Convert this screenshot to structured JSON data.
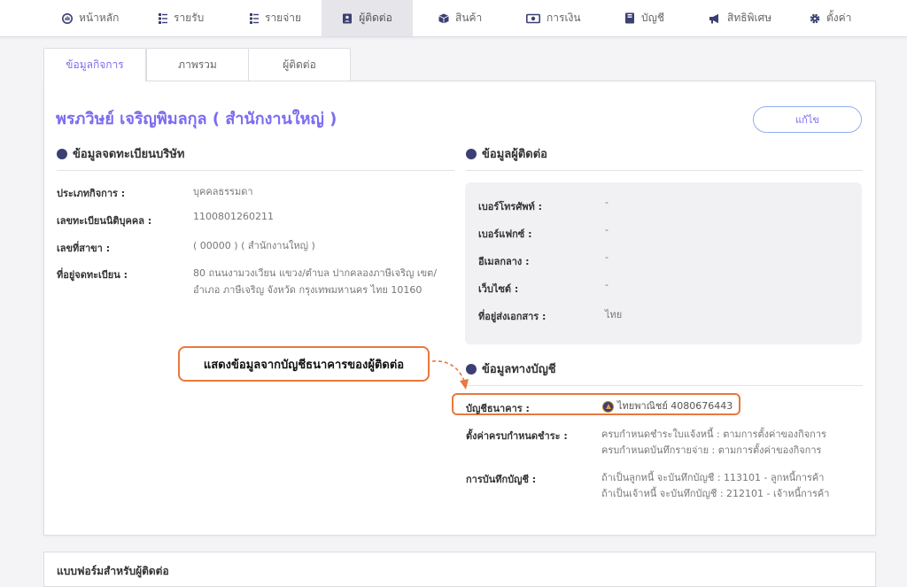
{
  "nav": [
    {
      "label": "หน้าหลัก",
      "icon": "dashboard-icon"
    },
    {
      "label": "รายรับ",
      "icon": "income-list-icon"
    },
    {
      "label": "รายจ่าย",
      "icon": "expense-list-icon"
    },
    {
      "label": "ผู้ติดต่อ",
      "icon": "contacts-icon",
      "active": true
    },
    {
      "label": "สินค้า",
      "icon": "product-box-icon"
    },
    {
      "label": "การเงิน",
      "icon": "money-icon"
    },
    {
      "label": "บัญชี",
      "icon": "accounting-book-icon"
    },
    {
      "label": "สิทธิพิเศษ",
      "icon": "megaphone-icon"
    },
    {
      "label": "ตั้งค่า",
      "icon": "gear-icon"
    }
  ],
  "tabs": [
    "ข้อมูลกิจการ",
    "ภาพรวม",
    "ผู้ติดต่อ"
  ],
  "title": "พรภวิษย์ เจริญพิมลกุล ( สำนักงานใหญ่ )",
  "edit_label": "แก้ไข",
  "registration": {
    "heading": "ข้อมูลจดทะเบียนบริษัท",
    "rows": [
      {
        "label": "ประเภทกิจการ :",
        "value": "บุคคลธรรมดา"
      },
      {
        "label": "เลขทะเบียนนิติบุคคล :",
        "value": "1100801260211"
      },
      {
        "label": "เลขที่สาขา :",
        "value": "( 00000 ) ( สำนักงานใหญ่ )"
      },
      {
        "label": "ที่อยู่จดทะเบียน :",
        "value": "80 ถนนงามวงเวียน แขวง/ตำบล ปากคลองภาษีเจริญ เขต/",
        "value2": "อำเภอ ภาษีเจริญ จังหวัด กรุงเทพมหานคร ไทย 10160"
      }
    ]
  },
  "contact": {
    "heading": "ข้อมูลผู้ติดต่อ",
    "rows": [
      {
        "label": "เบอร์โทรศัพท์ :",
        "value": "-"
      },
      {
        "label": "เบอร์แฟกซ์ :",
        "value": "-"
      },
      {
        "label": "อีเมลกลาง :",
        "value": "-"
      },
      {
        "label": "เว็บไซต์ :",
        "value": "-"
      },
      {
        "label": "ที่อยู่ส่งเอกสาร :",
        "value": "ไทย"
      }
    ]
  },
  "accounting": {
    "heading": "ข้อมูลทางบัญชี",
    "bank_label": "บัญชีธนาคาร :",
    "bank_value": "ไทยพาณิชย์ 4080676443",
    "due_label": "ตั้งค่าครบกำหนดชำระ :",
    "due_line1": "ครบกำหนดชำระใบแจ้งหนี้ : ตามการตั้งค่าของกิจการ",
    "due_line2": "ครบกำหนดบันทึกรายจ่าย : ตามการตั้งค่าของกิจการ",
    "record_label": "การบันทึกบัญชี :",
    "record_line1": "ถ้าเป็นลูกหนี้ จะบันทึกบัญชี : 113101 - ลูกหนี้การค้า",
    "record_line2": "ถ้าเป็นเจ้าหนี้ จะบันทึกบัญชี : 212101 - เจ้าหนี้การค้า"
  },
  "callout_text": "แสดงข้อมูลจากบัญชีธนาคารของผู้ติดต่อ",
  "next_section_heading": "แบบฟอร์มสำหรับผู้ติดต่อ",
  "colors": {
    "accent": "#7b6cf0",
    "nav_icon": "#3b3f73",
    "highlight": "#e8783e"
  }
}
